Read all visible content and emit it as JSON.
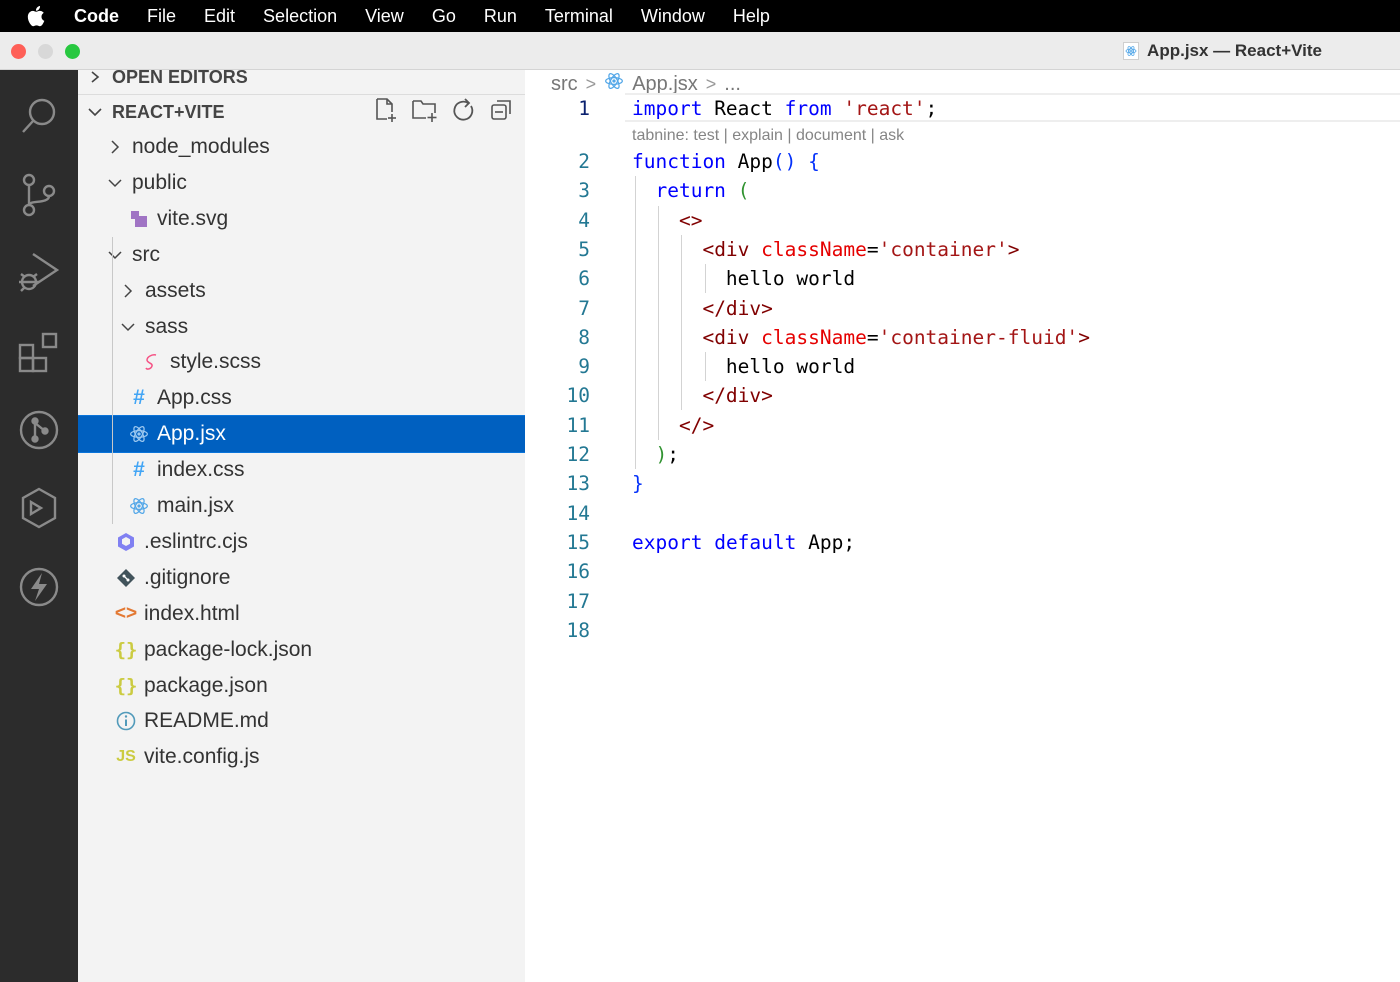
{
  "menubar": {
    "items": [
      "Code",
      "File",
      "Edit",
      "Selection",
      "View",
      "Go",
      "Run",
      "Terminal",
      "Window",
      "Help"
    ]
  },
  "window": {
    "title": "App.jsx — React+Vite",
    "traffic_lights": {
      "close": "#fe5f57",
      "minimize": "#d8d8d8",
      "maximize": "#28c840"
    }
  },
  "activity_bar": {
    "icons": [
      "search-icon",
      "source-control-icon",
      "run-debug-icon",
      "extensions-icon",
      "git-graph-icon",
      "remote-explorer-icon",
      "thunder-client-icon"
    ]
  },
  "explorer": {
    "open_editors_label": "OPEN EDITORS",
    "project_label": "REACT+VITE",
    "actions": [
      "new-file-icon",
      "new-folder-icon",
      "refresh-icon",
      "collapse-all-icon"
    ],
    "tree": [
      {
        "label": "node_modules",
        "type": "folder",
        "open": false,
        "depth": 0
      },
      {
        "label": "public",
        "type": "folder",
        "open": true,
        "depth": 0
      },
      {
        "label": "vite.svg",
        "type": "svg",
        "depth": 1
      },
      {
        "label": "src",
        "type": "folder",
        "open": true,
        "depth": 0
      },
      {
        "label": "assets",
        "type": "folder",
        "open": false,
        "depth": 1
      },
      {
        "label": "sass",
        "type": "folder",
        "open": true,
        "depth": 1
      },
      {
        "label": "style.scss",
        "type": "scss",
        "depth": 2
      },
      {
        "label": "App.css",
        "type": "css",
        "depth": 1
      },
      {
        "label": "App.jsx",
        "type": "react",
        "depth": 1,
        "selected": true
      },
      {
        "label": "index.css",
        "type": "css",
        "depth": 1
      },
      {
        "label": "main.jsx",
        "type": "react",
        "depth": 1
      },
      {
        "label": ".eslintrc.cjs",
        "type": "eslint",
        "depth": 0
      },
      {
        "label": ".gitignore",
        "type": "git",
        "depth": 0
      },
      {
        "label": "index.html",
        "type": "html",
        "depth": 0
      },
      {
        "label": "package-lock.json",
        "type": "json",
        "depth": 0
      },
      {
        "label": "package.json",
        "type": "json",
        "depth": 0
      },
      {
        "label": "README.md",
        "type": "info",
        "depth": 0
      },
      {
        "label": "vite.config.js",
        "type": "js",
        "depth": 0
      }
    ]
  },
  "breadcrumb": [
    "src",
    "App.jsx",
    "..."
  ],
  "editor": {
    "hint": "tabnine: test | explain | document | ask",
    "lines": [
      {
        "n": "1",
        "tokens": [
          [
            "kw",
            "import"
          ],
          [
            "def",
            " React "
          ],
          [
            "kw",
            "from"
          ],
          [
            "def",
            " "
          ],
          [
            "str",
            "'react'"
          ],
          [
            "def",
            ";"
          ]
        ]
      },
      {
        "n": "2",
        "tokens": [
          [
            "kw",
            "function"
          ],
          [
            "def",
            " App"
          ],
          [
            "br",
            "()"
          ],
          [
            "def",
            " "
          ],
          [
            "br",
            "{"
          ]
        ]
      },
      {
        "n": "3",
        "tokens": [
          [
            "def",
            "  "
          ],
          [
            "kw",
            "return"
          ],
          [
            "def",
            " "
          ],
          [
            "par",
            "("
          ]
        ]
      },
      {
        "n": "4",
        "tokens": [
          [
            "def",
            "    "
          ],
          [
            "tag",
            "<>"
          ]
        ]
      },
      {
        "n": "5",
        "tokens": [
          [
            "def",
            "      "
          ],
          [
            "tag",
            "<div"
          ],
          [
            "def",
            " "
          ],
          [
            "attr",
            "className"
          ],
          [
            "def",
            "="
          ],
          [
            "str",
            "'container'"
          ],
          [
            "tag",
            ">"
          ]
        ]
      },
      {
        "n": "6",
        "tokens": [
          [
            "def",
            "        hello world"
          ]
        ]
      },
      {
        "n": "7",
        "tokens": [
          [
            "def",
            "      "
          ],
          [
            "tag",
            "</div>"
          ]
        ]
      },
      {
        "n": "8",
        "tokens": [
          [
            "def",
            "      "
          ],
          [
            "tag",
            "<div"
          ],
          [
            "def",
            " "
          ],
          [
            "attr",
            "className"
          ],
          [
            "def",
            "="
          ],
          [
            "str",
            "'container-fluid'"
          ],
          [
            "tag",
            ">"
          ]
        ]
      },
      {
        "n": "9",
        "tokens": [
          [
            "def",
            "        hello world"
          ]
        ]
      },
      {
        "n": "10",
        "tokens": [
          [
            "def",
            "      "
          ],
          [
            "tag",
            "</div>"
          ]
        ]
      },
      {
        "n": "11",
        "tokens": [
          [
            "def",
            "    "
          ],
          [
            "tag",
            "</>"
          ]
        ]
      },
      {
        "n": "12",
        "tokens": [
          [
            "def",
            "  "
          ],
          [
            "par",
            ")"
          ],
          [
            "def",
            ";"
          ]
        ]
      },
      {
        "n": "13",
        "tokens": [
          [
            "br",
            "}"
          ]
        ]
      },
      {
        "n": "14",
        "tokens": []
      },
      {
        "n": "15",
        "tokens": [
          [
            "kw",
            "export"
          ],
          [
            "def",
            " "
          ],
          [
            "kw",
            "default"
          ],
          [
            "def",
            " App;"
          ]
        ]
      },
      {
        "n": "16",
        "tokens": []
      },
      {
        "n": "17",
        "tokens": []
      },
      {
        "n": "18",
        "tokens": []
      }
    ]
  }
}
